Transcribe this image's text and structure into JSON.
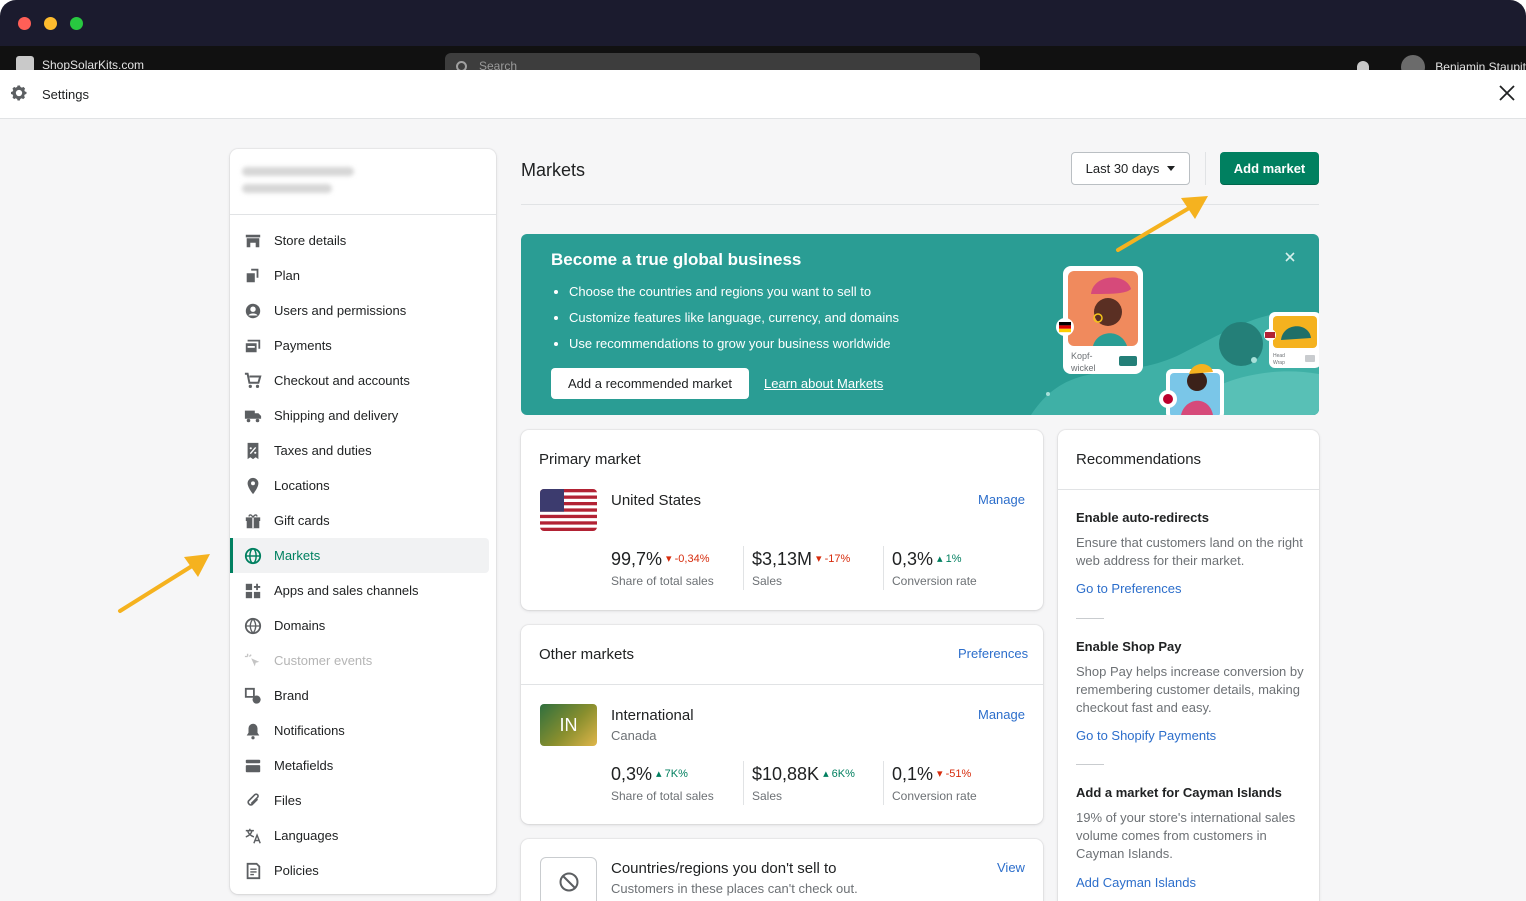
{
  "admin_bar": {
    "store_name": "ShopSolarKits.com",
    "search_placeholder": "Search",
    "user_name": "Benjamin Staupit"
  },
  "settings": {
    "title": "Settings",
    "nav": [
      {
        "label": "Store details",
        "icon": "store-icon"
      },
      {
        "label": "Plan",
        "icon": "plan-icon"
      },
      {
        "label": "Users and permissions",
        "icon": "user-icon"
      },
      {
        "label": "Payments",
        "icon": "payments-icon"
      },
      {
        "label": "Checkout and accounts",
        "icon": "cart-icon"
      },
      {
        "label": "Shipping and delivery",
        "icon": "truck-icon"
      },
      {
        "label": "Taxes and duties",
        "icon": "tax-icon"
      },
      {
        "label": "Locations",
        "icon": "location-pin-icon"
      },
      {
        "label": "Gift cards",
        "icon": "gift-icon"
      },
      {
        "label": "Markets",
        "icon": "globe-icon",
        "active": true
      },
      {
        "label": "Apps and sales channels",
        "icon": "apps-icon"
      },
      {
        "label": "Domains",
        "icon": "domain-globe-icon"
      },
      {
        "label": "Customer events",
        "icon": "cursor-icon",
        "disabled": true
      },
      {
        "label": "Brand",
        "icon": "brand-icon"
      },
      {
        "label": "Notifications",
        "icon": "bell-icon"
      },
      {
        "label": "Metafields",
        "icon": "metafields-icon"
      },
      {
        "label": "Files",
        "icon": "paperclip-icon"
      },
      {
        "label": "Languages",
        "icon": "language-icon"
      },
      {
        "label": "Policies",
        "icon": "policy-icon"
      }
    ]
  },
  "markets_page": {
    "title": "Markets",
    "date_range": "Last 30 days",
    "add_market_label": "Add market",
    "banner": {
      "title": "Become a true global business",
      "bullets": [
        "Choose the countries and regions you want to sell to",
        "Customize features like language, currency, and domains",
        "Use recommendations to grow your business worldwide"
      ],
      "button": "Add a recommended market",
      "link": "Learn about Markets",
      "illustration_label_1": "Kopf-",
      "illustration_label_2": "wickel",
      "illustration_label_3": "Head",
      "illustration_label_4": "Wrap"
    },
    "primary": {
      "heading": "Primary market",
      "country": "United States",
      "manage": "Manage",
      "metrics": [
        {
          "value": "99,7%",
          "change": "-0,34%",
          "dir": "down",
          "label": "Share of total sales"
        },
        {
          "value": "$3,13M",
          "change": "-17%",
          "dir": "down",
          "label": "Sales"
        },
        {
          "value": "0,3%",
          "change": "1%",
          "dir": "up",
          "label": "Conversion rate"
        }
      ]
    },
    "other": {
      "heading": "Other markets",
      "preferences": "Preferences",
      "market_code": "IN",
      "market_name": "International",
      "market_sub": "Canada",
      "manage": "Manage",
      "metrics": [
        {
          "value": "0,3%",
          "change": "7K%",
          "dir": "up",
          "label": "Share of total sales"
        },
        {
          "value": "$10,88K",
          "change": "6K%",
          "dir": "up",
          "label": "Sales"
        },
        {
          "value": "0,1%",
          "change": "-51%",
          "dir": "down",
          "label": "Conversion rate"
        }
      ]
    },
    "not_selling": {
      "title": "Countries/regions you don't sell to",
      "subtitle": "Customers in these places can't check out.",
      "link": "View"
    },
    "recommendations": {
      "heading": "Recommendations",
      "items": [
        {
          "title": "Enable auto-redirects",
          "text": "Ensure that customers land on the right web address for their market.",
          "link": "Go to Preferences"
        },
        {
          "title": "Enable Shop Pay",
          "text": "Shop Pay helps increase conversion by remembering customer details, making checkout fast and easy.",
          "link": "Go to Shopify Payments"
        },
        {
          "title": "Add a market for Cayman Islands",
          "text": "19% of your store's international sales volume comes from customers in Cayman Islands.",
          "link": "Add Cayman Islands"
        }
      ]
    }
  },
  "colors": {
    "primary_green": "#008060",
    "banner_teal": "#2a9d94",
    "link_blue": "#2c6ecb",
    "arrow_orange": "#f5b21f",
    "down_red": "#d72c0d",
    "up_green": "#007f5f"
  }
}
